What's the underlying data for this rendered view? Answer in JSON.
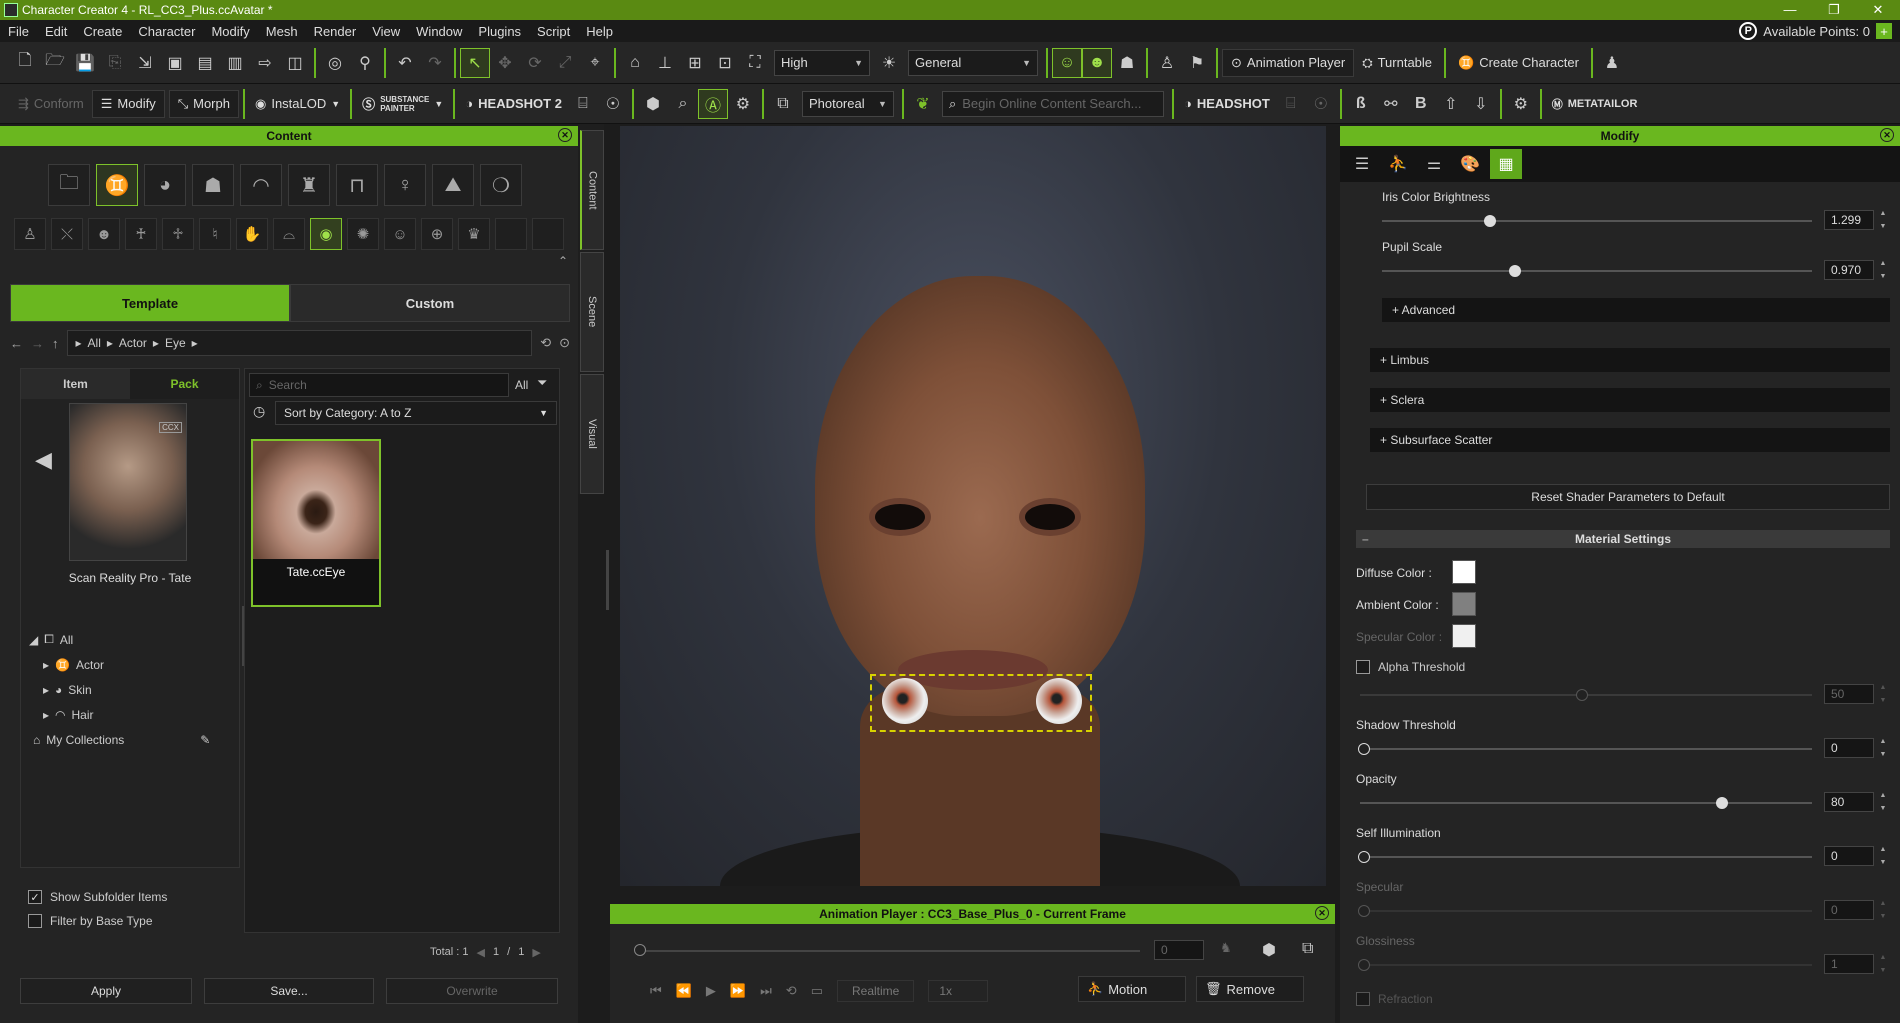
{
  "title": "Character Creator 4 - RL_CC3_Plus.ccAvatar *",
  "menu": [
    "File",
    "Edit",
    "Create",
    "Character",
    "Modify",
    "Mesh",
    "Render",
    "View",
    "Window",
    "Plugins",
    "Script",
    "Help"
  ],
  "available_points": "Available Points: 0",
  "toolbar1": {
    "quality": "High",
    "mode": "General",
    "animation_player": "Animation Player",
    "turntable": "Turntable",
    "create_character": "Create Character"
  },
  "toolbar2": {
    "conform": "Conform",
    "modify": "Modify",
    "morph": "Morph",
    "instalod": "InstaLOD",
    "substance_line1": "SUBSTANCE",
    "substance_line2": "PAINTER",
    "headshot2": "HEADSHOT 2",
    "render_mode": "Photoreal",
    "search_placeholder": "Begin Online Content Search...",
    "headshot": "HEADSHOT",
    "metatailor": "METATAILOR"
  },
  "content": {
    "title": "Content",
    "tab_template": "Template",
    "tab_custom": "Custom",
    "breadcrumb": [
      "All",
      "Actor",
      "Eye"
    ],
    "subtab_item": "Item",
    "subtab_pack": "Pack",
    "pack_label": "Scan Reality Pro - Tate",
    "pack_badge": "CCX",
    "tree": [
      "All",
      "Actor",
      "Skin",
      "Hair",
      "My Collections"
    ],
    "search_placeholder": "Search",
    "filter_all": "All",
    "sort": "Sort by Category: A to Z",
    "item_label": "Tate.ccEye",
    "show_subfolder": "Show Subfolder Items",
    "filter_base": "Filter by Base Type",
    "total": "Total : 1",
    "page_current": "1",
    "page_sep": "/",
    "page_total": "1",
    "apply": "Apply",
    "save": "Save...",
    "overwrite": "Overwrite"
  },
  "side_tabs": [
    "Content",
    "Scene",
    "Visual"
  ],
  "anim": {
    "title": "Animation Player : CC3_Base_Plus_0 - Current Frame",
    "frame": "0",
    "realtime": "Realtime",
    "speed": "1x",
    "motion": "Motion",
    "remove": "Remove"
  },
  "modify": {
    "title": "Modify",
    "iris_brightness_label": "Iris Color Brightness",
    "iris_brightness": "1.299",
    "iris_brightness_level": 0.25,
    "pupil_scale_label": "Pupil Scale",
    "pupil_scale": "0.970",
    "pupil_scale_level": 0.31,
    "advanced": "+ Advanced",
    "limbus": "+ Limbus",
    "sclera": "+ Sclera",
    "subsurface": "+ Subsurface Scatter",
    "reset": "Reset Shader Parameters to Default",
    "material_settings": "Material Settings",
    "diffuse": "Diffuse Color :",
    "ambient": "Ambient Color :",
    "specular_color": "Specular Color :",
    "alpha_threshold": "Alpha Threshold",
    "alpha_value": "50",
    "shadow_threshold": "Shadow Threshold",
    "shadow_value": "0",
    "opacity": "Opacity",
    "opacity_value": "80",
    "self_illum": "Self Illumination",
    "self_illum_value": "0",
    "specular": "Specular",
    "specular_value": "0",
    "glossiness": "Glossiness",
    "glossiness_value": "1",
    "refraction": "Refraction"
  },
  "colors": {
    "accent": "#6ab71f",
    "diffuse": "#ffffff",
    "ambient": "#808080",
    "specular": "#f0f0f0"
  }
}
